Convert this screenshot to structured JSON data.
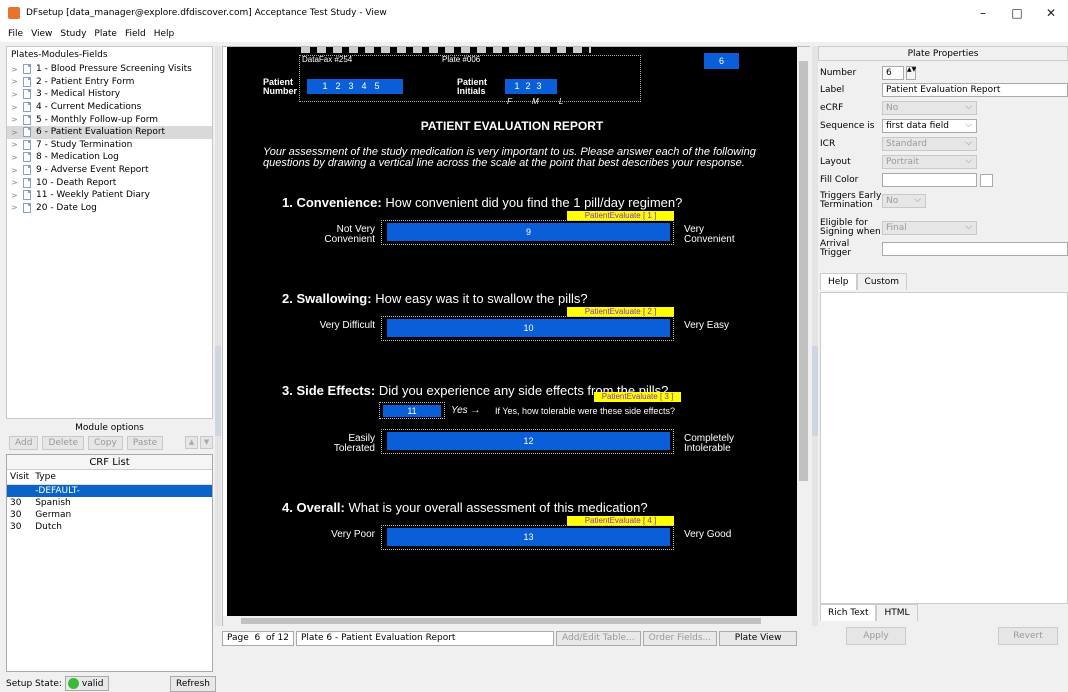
{
  "window": {
    "title": "DFsetup [data_manager@explore.dfdiscover.com] Acceptance Test Study - View",
    "minimize": "–",
    "maximize": "□",
    "close": "✕"
  },
  "menu": [
    "File",
    "View",
    "Study",
    "Plate",
    "Field",
    "Help"
  ],
  "tree": {
    "header": "Plates-Modules-Fields",
    "items": [
      {
        "label": "1 - Blood Pressure Screening Visits"
      },
      {
        "label": "2 - Patient Entry Form"
      },
      {
        "label": "3 - Medical History"
      },
      {
        "label": "4 - Current Medications"
      },
      {
        "label": "5 - Monthly Follow-up Form"
      },
      {
        "label": "6 - Patient Evaluation Report",
        "selected": true
      },
      {
        "label": "7 - Study Termination"
      },
      {
        "label": "8 - Medication Log"
      },
      {
        "label": "9 - Adverse Event Report"
      },
      {
        "label": "10 - Death Report"
      },
      {
        "label": "11 - Weekly Patient Diary"
      },
      {
        "label": "20 - Date Log"
      }
    ]
  },
  "module_options": {
    "label": "Module options",
    "add": "Add",
    "delete": "Delete",
    "copy": "Copy",
    "paste": "Paste"
  },
  "crf_list": {
    "title": "CRF List",
    "col_visit": "Visit",
    "col_type": "Type",
    "rows": [
      {
        "visit": "",
        "type": "-DEFAULT-",
        "selected": true
      },
      {
        "visit": "30",
        "type": "Spanish"
      },
      {
        "visit": "30",
        "type": "German"
      },
      {
        "visit": "30",
        "type": "Dutch"
      }
    ]
  },
  "setup": {
    "label": "Setup State:",
    "state": "valid",
    "refresh": "Refresh"
  },
  "form": {
    "datafax": "DataFax #254",
    "plate": "Plate #006",
    "plate_box": "6",
    "patient_number_label": "Patient Number",
    "patient_initials_label": "Patient Initials",
    "initials_letters": "F M L",
    "title": "PATIENT EVALUATION REPORT",
    "intro1": "Your assessment of the study medication is very important to us. Please answer each of the following",
    "intro2": "questions by drawing a vertical line across the scale at the point that best describes your response.",
    "q1_label": "1. Convenience:",
    "q1_text": "How convenient did you find the 1 pill/day regimen?",
    "q1_tag": "PatientEvaluate [ 1 ]",
    "q1_left": "Not Very Convenient",
    "q1_right": "Very Convenient",
    "q1_num": "9",
    "q2_label": "2. Swallowing:",
    "q2_text": "How easy was it to swallow the pills?",
    "q2_tag": "PatientEvaluate [ 2 ]",
    "q2_left": "Very Difficult",
    "q2_right": "Very Easy",
    "q2_num": "10",
    "q3_label": "3. Side Effects:",
    "q3_text": "Did you experience any side effects from the pills?",
    "q3_tag": "PatientEvaluate [ 3 ]",
    "q3_yes": "Yes  →",
    "q3_if": "If Yes, how tolerable were these side effects?",
    "q3_num_small": "11",
    "q3_left": "Easily Tolerated",
    "q3_right": "Completely Intolerable",
    "q3_num": "12",
    "q4_label": "4. Overall:",
    "q4_text": "What is your overall assessment of this medication?",
    "q4_tag": "PatientEvaluate [ 4 ]",
    "q4_left": "Very Poor",
    "q4_right": "Very Good",
    "q4_num": "13"
  },
  "plate_properties": {
    "title": "Plate Properties",
    "number_label": "Number",
    "number": "6",
    "label_label": "Label",
    "label": "Patient Evaluation Report",
    "ecrf_label": "eCRF",
    "ecrf": "No",
    "sequence_label": "Sequence is",
    "sequence": "first data field",
    "icr_label": "ICR",
    "icr": "Standard",
    "layout_label": "Layout",
    "layout": "Portrait",
    "fill_label": "Fill Color",
    "triggers_label": "Triggers Early Termination",
    "triggers": "No",
    "eligible_label": "Eligible for Signing when",
    "eligible": "Final",
    "arrival_label": "Arrival Trigger",
    "tab_help": "Help",
    "tab_custom": "Custom",
    "tab_rich": "Rich Text",
    "tab_html": "HTML",
    "apply": "Apply",
    "revert": "Revert"
  },
  "status": {
    "page_label": "Page",
    "page": "6",
    "of": "of 12",
    "plate_desc": "Plate 6 - Patient Evaluation Report",
    "add_edit": "Add/Edit Table...",
    "order": "Order Fields...",
    "plate_view": "Plate View"
  }
}
